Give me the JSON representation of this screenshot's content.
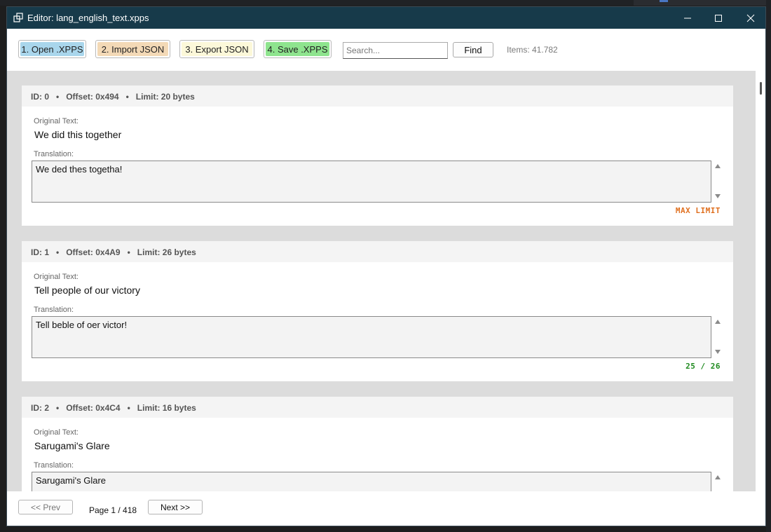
{
  "window": {
    "title": "Editor: lang_english_text.xpps"
  },
  "toolbar": {
    "open_label": "1. Open .XPPS",
    "import_label": "2. Import JSON",
    "export_label": "3. Export JSON",
    "save_label": "4. Save .XPPS",
    "search_placeholder": "Search...",
    "find_label": "Find",
    "items_count": "Items: 41.782",
    "colors": {
      "open": "#a9d6ec",
      "import": "#f3d9b6",
      "export": "#fcf8d9",
      "save": "#8ee48e"
    }
  },
  "labels": {
    "original": "Original Text:",
    "translation": "Translation:",
    "bullet": "•"
  },
  "entries": [
    {
      "id": "ID: 0",
      "offset": "Offset: 0x494",
      "limit": "Limit: 20 bytes",
      "original": "We did this together",
      "translation": "We ded thes togetha!",
      "status": "MAX LIMIT",
      "status_color": "#e07020"
    },
    {
      "id": "ID: 1",
      "offset": "Offset: 0x4A9",
      "limit": "Limit: 26 bytes",
      "original": "Tell people of our victory",
      "translation": "Tell beble of oer victor!",
      "status": "25 / 26",
      "status_color": "#1e8a1e"
    },
    {
      "id": "ID: 2",
      "offset": "Offset: 0x4C4",
      "limit": "Limit: 16 bytes",
      "original": "Sarugami's Glare",
      "translation": "Sarugami's Glare",
      "status": "",
      "status_color": "#1e8a1e"
    }
  ],
  "footer": {
    "prev_label": "<< Prev",
    "page_info": "Page 1 / 418",
    "next_label": "Next >>"
  },
  "icons": {
    "app": "window-stack-icon",
    "minimize": "minimize-icon",
    "maximize": "maximize-icon",
    "close": "close-icon"
  }
}
